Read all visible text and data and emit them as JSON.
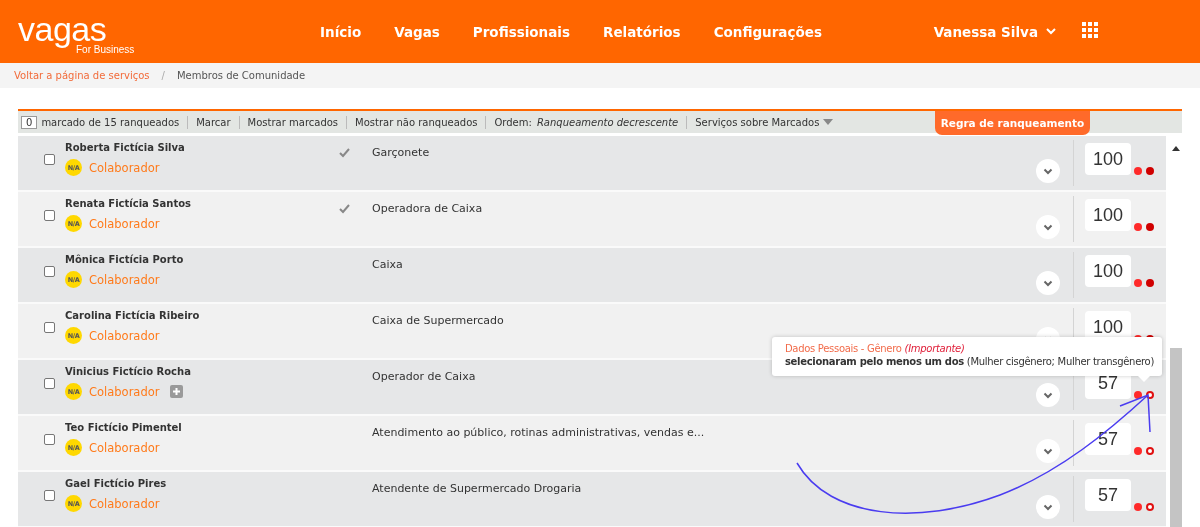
{
  "header": {
    "logo": "vagas",
    "logo_subtitle": "For Business",
    "nav": [
      {
        "label": "Início"
      },
      {
        "label": "Vagas"
      },
      {
        "label": "Profissionais"
      },
      {
        "label": "Relatórios"
      },
      {
        "label": "Configurações"
      }
    ],
    "user": "Vanessa Silva"
  },
  "breadcrumb": [
    {
      "label": "Voltar a página de serviços",
      "link": true
    },
    {
      "label": "Membros de Comunidade",
      "link": false
    }
  ],
  "breadcrumb_separator": "/",
  "toolbar": {
    "count": "0",
    "count_label": "marcado de 15 ranqueados",
    "actions": [
      "Marcar",
      "Mostrar marcados",
      "Mostrar não ranqueados"
    ],
    "order_label": "Ordem:",
    "order_value": "Ranqueamento decrescente",
    "services": "Serviços sobre Marcados",
    "rule_button": "Regra de ranqueamento"
  },
  "rows": [
    {
      "checked": false,
      "name": "Roberta Fictícia Silva",
      "badge": "N/A",
      "role": "Colaborador",
      "verified": true,
      "expandable": false,
      "job": "Garçonete",
      "score": "100",
      "dots": [
        {
          "filled": true
        },
        {
          "filled": true
        }
      ]
    },
    {
      "checked": false,
      "name": "Renata Fictícia Santos",
      "badge": "N/A",
      "role": "Colaborador",
      "verified": true,
      "expandable": false,
      "job": "Operadora de Caixa",
      "score": "100",
      "dots": [
        {
          "filled": true
        },
        {
          "filled": true
        }
      ]
    },
    {
      "checked": false,
      "name": "Mônica Fictícia Porto",
      "badge": "N/A",
      "role": "Colaborador",
      "verified": false,
      "expandable": false,
      "job": "Caixa",
      "score": "100",
      "dots": [
        {
          "filled": true
        },
        {
          "filled": true
        }
      ]
    },
    {
      "checked": false,
      "name": "Carolina Fictícia Ribeiro",
      "badge": "N/A",
      "role": "Colaborador",
      "verified": false,
      "expandable": false,
      "job": "Caixa de Supermercado",
      "score": "100",
      "dots": [
        {
          "filled": true
        },
        {
          "filled": true
        }
      ]
    },
    {
      "checked": false,
      "name": "Vinicius Fictício Rocha",
      "badge": "N/A",
      "role": "Colaborador",
      "verified": false,
      "expandable": true,
      "job": "Operador de Caixa",
      "score": "57",
      "dots": [
        {
          "filled": true
        },
        {
          "filled": false
        }
      ]
    },
    {
      "checked": false,
      "name": "Teo Fictício Pimentel",
      "badge": "N/A",
      "role": "Colaborador",
      "verified": false,
      "expandable": false,
      "job": "Atendimento ao público, rotinas administrativas, vendas e...",
      "score": "57",
      "dots": [
        {
          "filled": true
        },
        {
          "filled": false
        }
      ]
    },
    {
      "checked": false,
      "name": "Gael Fictício Pires",
      "badge": "N/A",
      "role": "Colaborador",
      "verified": false,
      "expandable": false,
      "job": "Atendente de Supermercado Drogaria",
      "score": "57",
      "dots": [
        {
          "filled": true
        },
        {
          "filled": false
        }
      ]
    }
  ],
  "tooltip": {
    "title": "Dados Pessoais - Gênero",
    "importance": "(Importante)",
    "text": "**selecionaram pelo menos um dos** (Mulher cisgênero; Mulher transgênero)"
  }
}
